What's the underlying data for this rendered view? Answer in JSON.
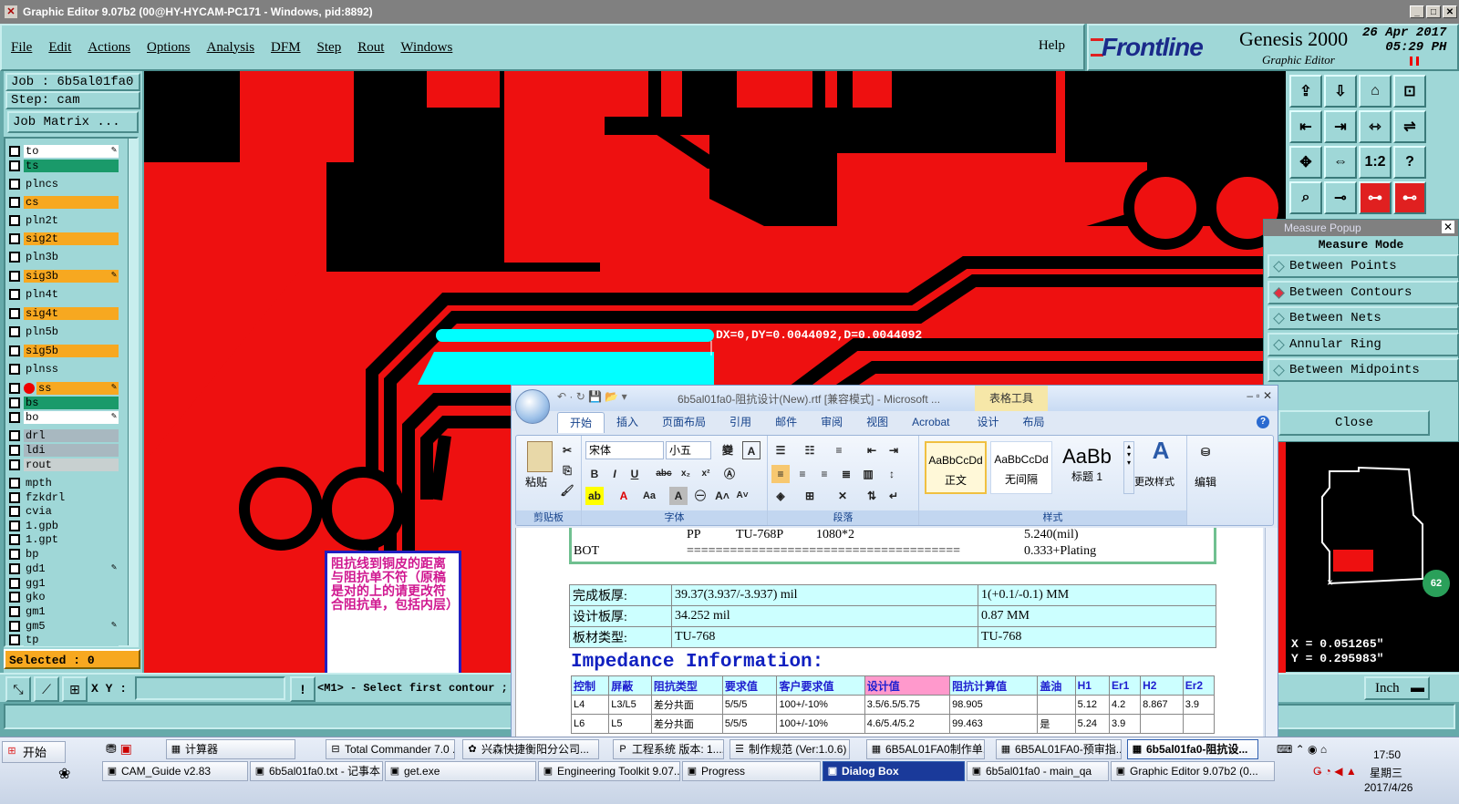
{
  "window": {
    "title": "Graphic Editor 9.07b2 (00@HY-HYCAM-PC171 - Windows, pid:8892)"
  },
  "menu": {
    "items": [
      "File",
      "Edit",
      "Actions",
      "Options",
      "Analysis",
      "DFM",
      "Step",
      "Rout",
      "Windows"
    ],
    "help": "Help"
  },
  "brand": {
    "name": "Frontline",
    "product": "Genesis 2000",
    "subtitle": "Graphic Editor",
    "date": "26 Apr 2017",
    "time": "05:29 PH"
  },
  "job": {
    "job_label": "Job : 6b5al01fa0",
    "step_label": "Step: cam",
    "matrix_button": "Job Matrix ..."
  },
  "layers": [
    {
      "name": "to",
      "color": "#ffffff",
      "pen": true
    },
    {
      "name": "ts",
      "color": "#1a9a6a",
      "pen": false
    },
    {
      "name": "plncs",
      "color": "#9fd7d7",
      "pen": false
    },
    {
      "name": "cs",
      "color": "#f7a820",
      "pen": false
    },
    {
      "name": "pln2t",
      "color": "#9fd7d7",
      "pen": false
    },
    {
      "name": "sig2t",
      "color": "#f7a820",
      "pen": false
    },
    {
      "name": "pln3b",
      "color": "#9fd7d7",
      "pen": false
    },
    {
      "name": "sig3b",
      "color": "#f7a820",
      "pen": true
    },
    {
      "name": "pln4t",
      "color": "#9fd7d7",
      "pen": false
    },
    {
      "name": "sig4t",
      "color": "#f7a820",
      "pen": false
    },
    {
      "name": "pln5b",
      "color": "#9fd7d7",
      "pen": false
    },
    {
      "name": "sig5b",
      "color": "#f7a820",
      "pen": false
    },
    {
      "name": "plnss",
      "color": "#9fd7d7",
      "pen": false
    },
    {
      "name": "ss",
      "color": "#f7a820",
      "pen": true
    },
    {
      "name": "bs",
      "color": "#1a9a6a",
      "pen": false
    },
    {
      "name": "bo",
      "color": "#ffffff",
      "pen": true
    },
    {
      "name": "drl",
      "color": "#a8b8c0",
      "pen": false
    },
    {
      "name": "ldi",
      "color": "#a8b8c0",
      "pen": false
    },
    {
      "name": "rout",
      "color": "#c8d0d0",
      "pen": false
    },
    {
      "name": "mpth",
      "color": "#9fd7d7",
      "pen": false
    },
    {
      "name": "fzkdrl",
      "color": "#9fd7d7",
      "pen": false
    },
    {
      "name": "cvia",
      "color": "#9fd7d7",
      "pen": false
    },
    {
      "name": "1.gpb",
      "color": "#9fd7d7",
      "pen": false
    },
    {
      "name": "1.gpt",
      "color": "#9fd7d7",
      "pen": false
    },
    {
      "name": "bp",
      "color": "#9fd7d7",
      "pen": false
    },
    {
      "name": "gd1",
      "color": "#9fd7d7",
      "pen": true
    },
    {
      "name": "gg1",
      "color": "#9fd7d7",
      "pen": false
    },
    {
      "name": "gko",
      "color": "#9fd7d7",
      "pen": false
    },
    {
      "name": "gm1",
      "color": "#9fd7d7",
      "pen": false
    },
    {
      "name": "gm5",
      "color": "#9fd7d7",
      "pen": true
    },
    {
      "name": "tp",
      "color": "#9fd7d7",
      "pen": false
    }
  ],
  "selected": "Selected : 0",
  "canvas": {
    "measure_readout": "DX=0,DY=0.0044092,D=0.0044092",
    "copper_color": "#ee1010",
    "highlight_color": "#00ffff"
  },
  "note": {
    "text": "阻抗线到铜皮的距离与阻抗单不符（原稿是对的上的请更改符合阻抗单，包括内层）"
  },
  "toolbar": {
    "icons": [
      "zoom-home-icon",
      "zoom-back-icon",
      "home-step-icon",
      "grid-icon",
      "zoom-in-icon",
      "zoom-out-icon",
      "fit-icon",
      "snap-icon",
      "pan-icon",
      "move-icon",
      "one-to-one-icon",
      "help-icon",
      "filter-icon",
      "drill-icon",
      "layer-red-icon",
      "layer-red2-icon"
    ],
    "labels": [
      "",
      "",
      "",
      "",
      "",
      "",
      "",
      "",
      "",
      "",
      "1:2",
      "?",
      "",
      "",
      "",
      ""
    ]
  },
  "measure": {
    "title": "Measure Popup",
    "mode_label": "Measure Mode",
    "options": [
      {
        "label": "Between Points",
        "selected": false
      },
      {
        "label": "Between Contours",
        "selected": true
      },
      {
        "label": "Between Nets",
        "selected": false
      },
      {
        "label": "Annular Ring",
        "selected": false
      },
      {
        "label": "Between Midpoints",
        "selected": false
      }
    ],
    "close_label": "Close"
  },
  "coords": {
    "x": "X = 0.051265\"",
    "y": "Y = 0.295983\""
  },
  "minimap_badge": "62",
  "cmd": {
    "xy_label": "X Y :",
    "xy_value": "",
    "prompt": "<M1> - Select first contour ; <",
    "units": "Inch",
    "bang": "!"
  },
  "word": {
    "title": "6b5al01fa0-阻抗设计(New).rtf [兼容模式] - Microsoft ...",
    "context_tab": "表格工具",
    "tabs": [
      "开始",
      "插入",
      "页面布局",
      "引用",
      "邮件",
      "审阅",
      "视图",
      "Acrobat",
      "设计",
      "布局"
    ],
    "font_name": "宋体",
    "font_size": "小五",
    "groups": {
      "clipboard": "剪贴板",
      "font": "字体",
      "paragraph": "段落",
      "styles": "样式",
      "paste": "粘贴",
      "change_styles": "更改样式",
      "edit": "编辑"
    },
    "styles": [
      {
        "preview": "AaBbCcDd",
        "name": "正文"
      },
      {
        "preview": "AaBbCcDd",
        "name": "无间隔"
      },
      {
        "preview": "AaBb",
        "name": "标题 1"
      }
    ],
    "doc": {
      "pp_row": {
        "col1": "PP",
        "col2": "TU-768P",
        "col3": "1080*2",
        "col4": "5.240(mil)"
      },
      "bot_row": {
        "col1": "BOT",
        "col2": "======================================",
        "col3": "0.333+Plating"
      },
      "specs": [
        {
          "label": "完成板厚:",
          "value": "39.37(3.937/-3.937) mil",
          "extra": "1(+0.1/-0.1) MM"
        },
        {
          "label": "设计板厚:",
          "value": "34.252 mil",
          "extra": "0.87 MM"
        },
        {
          "label": "板材类型:",
          "value": "TU-768",
          "extra": "TU-768"
        }
      ],
      "impedance_title": "Impedance Information:",
      "imp_headers": [
        "控制",
        "屏蔽",
        "阻抗类型",
        "要求值",
        "客户要求值",
        "设计值",
        "阻抗计算值",
        "盖油",
        "H1",
        "Er1",
        "H2",
        "Er2"
      ],
      "imp_rows": [
        [
          "L4",
          "L3/L5",
          "差分共面",
          "5/5/5",
          "100+/-10%",
          "3.5/6.5/5.75",
          "98.905",
          "",
          "5.12",
          "4.2",
          "8.867",
          "3.9"
        ],
        [
          "L6",
          "L5",
          "差分共面",
          "5/5/5",
          "100+/-10%",
          "4.6/5.4/5.2",
          "99.463",
          "是",
          "5.24",
          "3.9",
          "",
          ""
        ]
      ]
    }
  },
  "taskbar": {
    "start": "开始",
    "row1": [
      "计算器",
      "Total Commander 7.0 ...",
      "兴森快捷衡阳分公司...",
      "工程系统  版本: 1....",
      "制作规范 (Ver:1.0.6)",
      "6B5AL01FA0制作单.x...",
      "6B5AL01FA0-预审指...",
      "6b5al01fa0-阻抗设..."
    ],
    "row2": [
      "CAM_Guide v2.83",
      "6b5al01fa0.txt - 记事本",
      "get.exe",
      "Engineering Toolkit 9.07...",
      "Progress",
      "Dialog Box",
      "6b5al01fa0 - main_qa",
      "Graphic Editor 9.07b2 (0..."
    ],
    "clock": "17:50",
    "day": "星期三",
    "date": "2017/4/26"
  }
}
